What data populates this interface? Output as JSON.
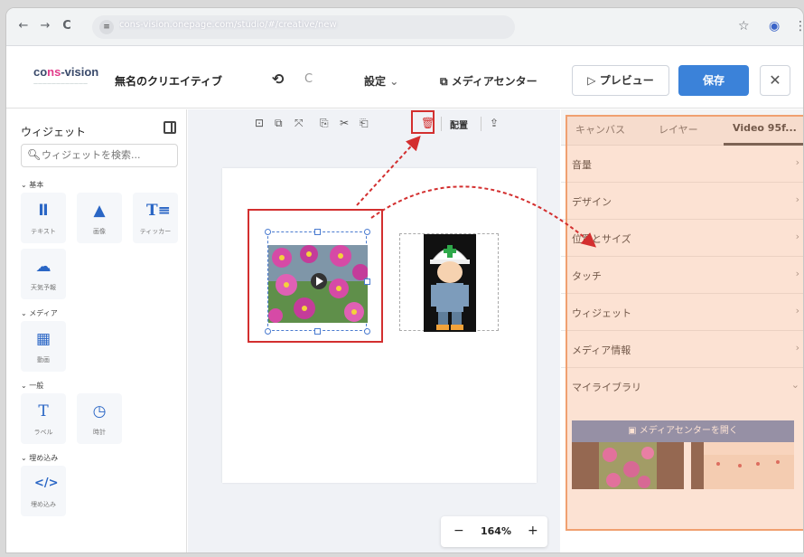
{
  "browser": {
    "url": "cons-vision.onepage.com/studio/#/creative/new",
    "back_icon": "←",
    "forward_icon": "→",
    "reload_icon": "C"
  },
  "header": {
    "logo_a": "co",
    "logo_hl": "ns",
    "logo_b": "-vision",
    "title": "無名のクリエイティブ",
    "undo_icon": "⟲",
    "redo_icon": "C",
    "settings_label": "設定",
    "media_center_label": "メディアセンター",
    "preview_label": "プレビュー",
    "save_label": "保存",
    "close_label": "✕"
  },
  "sidebar": {
    "title": "ウィジェット",
    "search_placeholder": "ウィジェットを検索...",
    "sections": {
      "basic": "基本",
      "media": "メディア",
      "general": "一般",
      "embed": "埋め込み"
    },
    "widgets": {
      "text": "テキスト",
      "image": "画像",
      "ticker": "ティッカー",
      "weather": "天気予報",
      "video": "動画",
      "label": "ラベル",
      "clock": "時計",
      "embed": "埋め込み"
    }
  },
  "toolbar": {
    "arrange_label": "配置"
  },
  "zoom": {
    "minus": "−",
    "value": "164%",
    "plus": "+"
  },
  "right_panel": {
    "tabs": [
      "キャンバス",
      "レイヤー",
      "Video 95f..."
    ],
    "rows": [
      "音量",
      "デザイン",
      "位置とサイズ",
      "タッチ",
      "ウィジェット",
      "メディア情報",
      "マイライブラリ"
    ],
    "media_center_button": "メディアセンターを開く"
  },
  "colors": {
    "accent": "#3b82d9",
    "annotation_red": "#d32f2f",
    "panel_highlight": "#f0a070"
  }
}
